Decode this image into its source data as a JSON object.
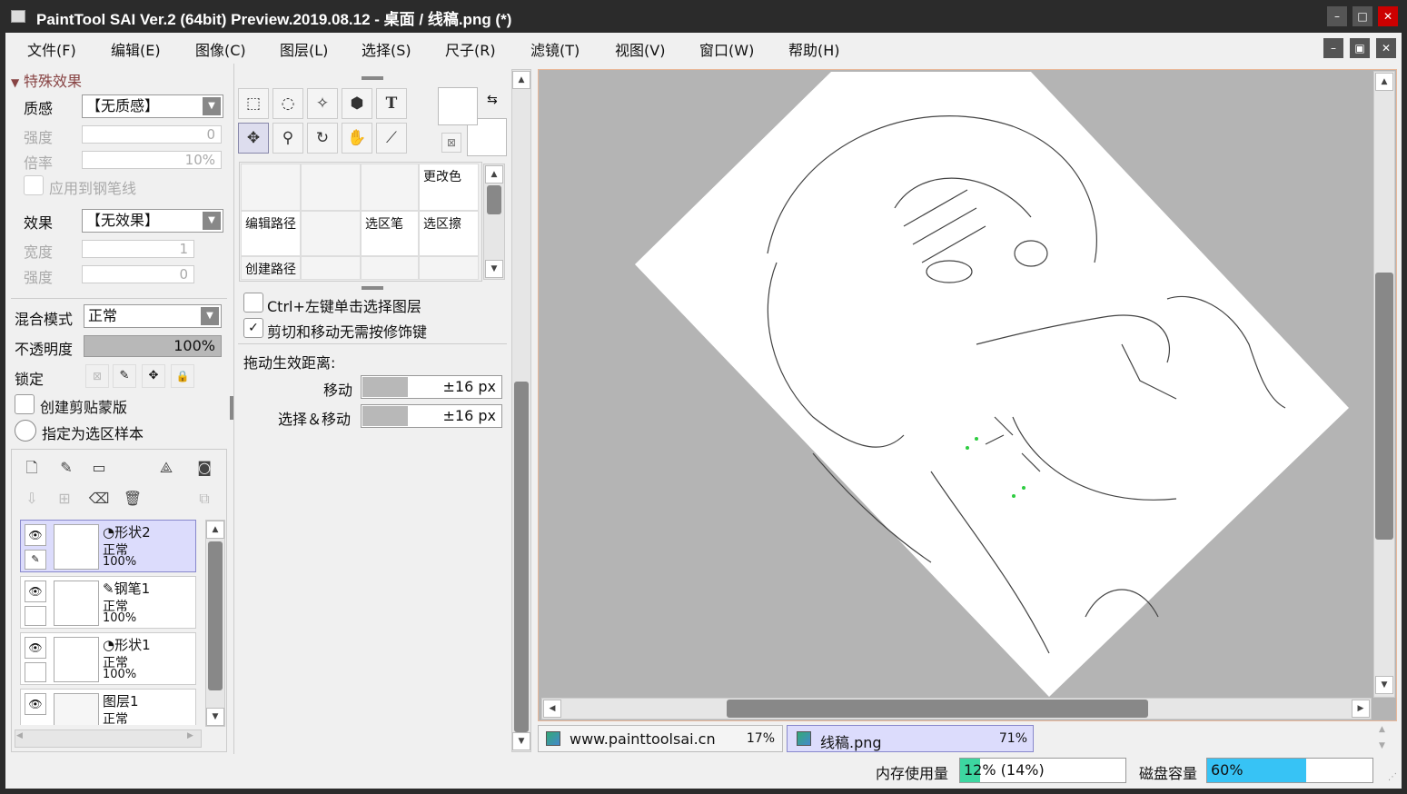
{
  "window": {
    "title": "PaintTool SAI Ver.2 (64bit) Preview.2019.08.12 - 桌面 / 线稿.png (*)",
    "min": "–",
    "max": "□",
    "close": "✕"
  },
  "menu": [
    "文件(F)",
    "编辑(E)",
    "图像(C)",
    "图层(L)",
    "选择(S)",
    "尺子(R)",
    "滤镜(T)",
    "视图(V)",
    "窗口(W)",
    "帮助(H)"
  ],
  "menu_controls": {
    "min": "–",
    "restore": "▣",
    "close": "✕"
  },
  "effects": {
    "section": "特殊效果",
    "texture_label": "质感",
    "texture_value": "【无质感】",
    "strength_label": "强度",
    "strength_value": "0",
    "scale_label": "倍率",
    "scale_value": "10%",
    "apply_pen": "应用到钢笔线",
    "effect_label": "效果",
    "effect_value": "【无效果】",
    "width_label": "宽度",
    "width_value": "1",
    "strength2_label": "强度",
    "strength2_value": "0"
  },
  "layer_props": {
    "blend_label": "混合模式",
    "blend_value": "正常",
    "opacity_label": "不透明度",
    "opacity_value": "100%",
    "opacity_fraction": 1.0,
    "lock_label": "锁定",
    "clip": "创建剪贴蒙版",
    "sample": "指定为选区样本"
  },
  "layers": [
    {
      "name": "形状2",
      "mode": "正常",
      "opacity": "100%",
      "type_icon": "◔",
      "selected": true
    },
    {
      "name": "钢笔1",
      "mode": "正常",
      "opacity": "100%",
      "type_icon": "✎",
      "selected": false
    },
    {
      "name": "形状1",
      "mode": "正常",
      "opacity": "100%",
      "type_icon": "◔",
      "selected": false
    },
    {
      "name": "图层1",
      "mode": "正常",
      "opacity": "",
      "type_icon": "",
      "selected": false
    }
  ],
  "tools": {
    "row1": [
      "⬚",
      "◌",
      "✧",
      "⬢",
      "T"
    ],
    "row2": [
      "✥",
      "⚲",
      "↻",
      "✋",
      "⟋"
    ],
    "swap": "⇆",
    "reset": "⊠"
  },
  "brushes": {
    "recolor": "更改色",
    "edit_path": "编辑路径",
    "sel_pen": "选区笔",
    "sel_erase": "选区擦",
    "create_path": "创建路径"
  },
  "options": {
    "ctrl_click": "Ctrl+左键单击选择图层",
    "cut_move": "剪切和移动无需按修饰键",
    "cut_move_check": "✓",
    "drag_label": "拖动生效距离:",
    "move_label": "移动",
    "move_value": "±16 px",
    "selmove_label": "选择＆移动",
    "selmove_value": "±16 px"
  },
  "docs": [
    {
      "name": "www.painttoolsai.cn",
      "zoom": "17%"
    },
    {
      "name": "线稿.png",
      "zoom": "71%"
    }
  ],
  "status": {
    "mem_label": "内存使用量",
    "mem_value": "12% (14%)",
    "mem_fraction": 0.12,
    "disk_label": "磁盘容量",
    "disk_value": "60%",
    "disk_fraction": 0.6
  },
  "colors": {
    "accent_bar": "#37c3f5",
    "mem_bar": "#3dd6a0",
    "selected": "#dcdcfc"
  }
}
